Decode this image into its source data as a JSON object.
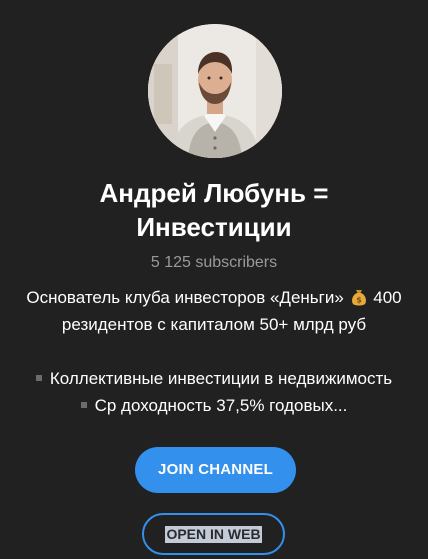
{
  "channel": {
    "title_line1": "Андрей Любунь =",
    "title_line2": "Инвестиции",
    "subscribers": "5 125 subscribers",
    "description": {
      "line1_before_emoji": "Основатель клуба инвесторов «Деньги»",
      "line1_after_emoji": "400",
      "line2": "резидентов с капиталом 50+ млрд руб",
      "bullet1": "Коллективные инвестиции в недвижимость",
      "bullet2": "Ср доходность 37,5% годовых..."
    },
    "emoji_icon": "money-bag-icon"
  },
  "actions": {
    "join_label": "JOIN CHANNEL",
    "open_web_label": "OPEN IN WEB"
  },
  "colors": {
    "background": "#212121",
    "accent": "#3390ec",
    "muted_text": "#9a9a9a",
    "selection_highlight": "#c3cbd9"
  }
}
